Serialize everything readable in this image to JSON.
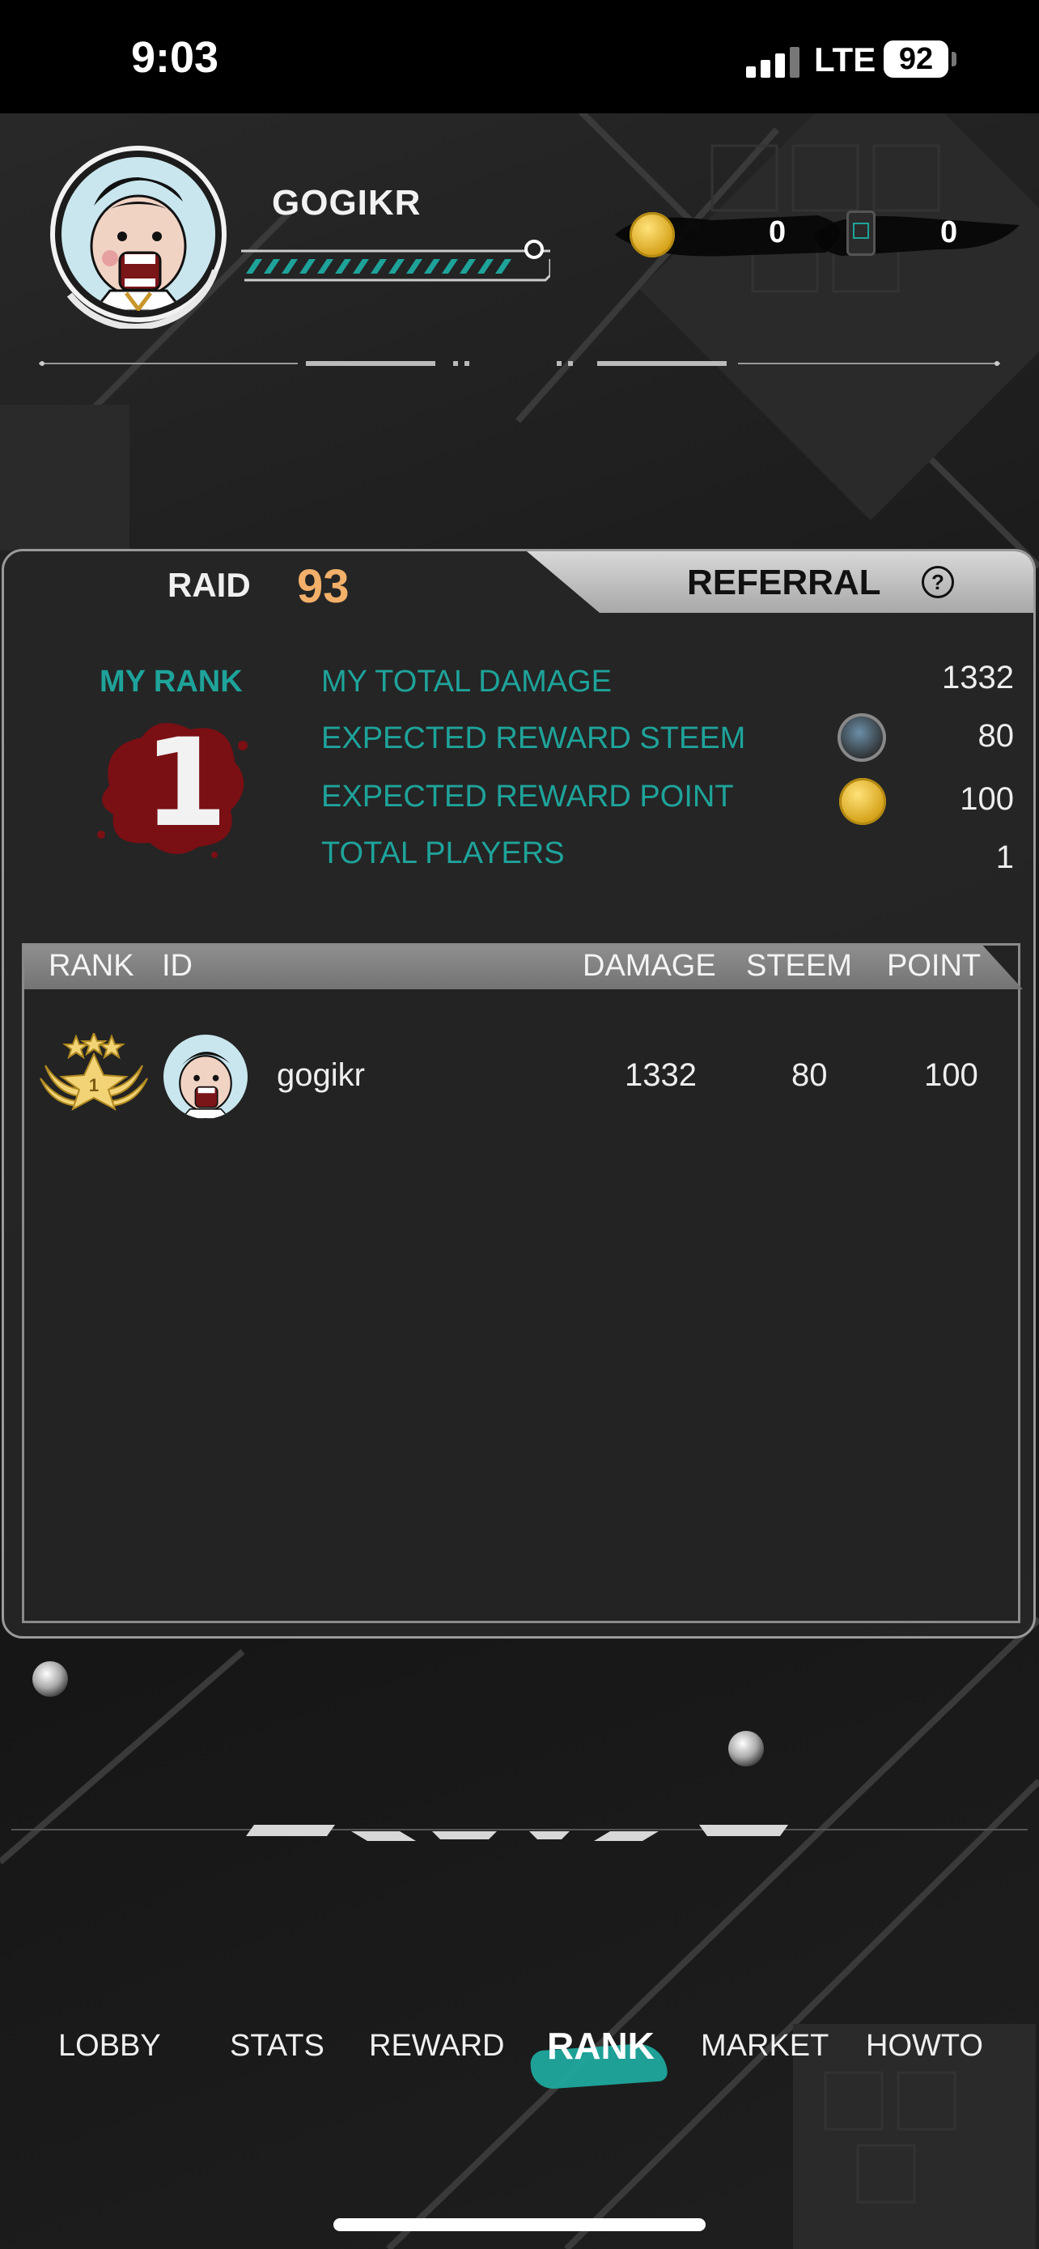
{
  "status_bar": {
    "time": "9:03",
    "network": "LTE",
    "battery": "92"
  },
  "profile": {
    "username": "GOGIKR",
    "coins_value": "0",
    "tickets_value": "0"
  },
  "raid_panel": {
    "tabs": {
      "raid_label": "RAID",
      "raid_number": "93",
      "referral_label": "REFERRAL",
      "help_glyph": "?"
    },
    "my_rank_label": "MY RANK",
    "my_rank_value": "1",
    "stats": [
      {
        "label": "MY TOTAL DAMAGE",
        "value": "1332"
      },
      {
        "label": "EXPECTED REWARD STEEM",
        "value": "80",
        "icon": "steem-icon"
      },
      {
        "label": "EXPECTED REWARD POINT",
        "value": "100",
        "icon": "point-coin-icon"
      },
      {
        "label": "TOTAL PLAYERS",
        "value": "1"
      }
    ],
    "table": {
      "headers": {
        "rank": "RANK",
        "id": "ID",
        "damage": "DAMAGE",
        "steem": "STEEM",
        "point": "POINT"
      },
      "rows": [
        {
          "rank": "1",
          "id": "gogikr",
          "damage": "1332",
          "steem": "80",
          "point": "100"
        }
      ]
    }
  },
  "nav": {
    "items": [
      "LOBBY",
      "STATS",
      "REWARD",
      "RANK",
      "MARKET",
      "HOWTO"
    ],
    "active": "RANK"
  },
  "colors": {
    "accent_teal": "#1ea39a",
    "raid_number": "#f3b06a",
    "rank_splat": "#7a0f14"
  }
}
